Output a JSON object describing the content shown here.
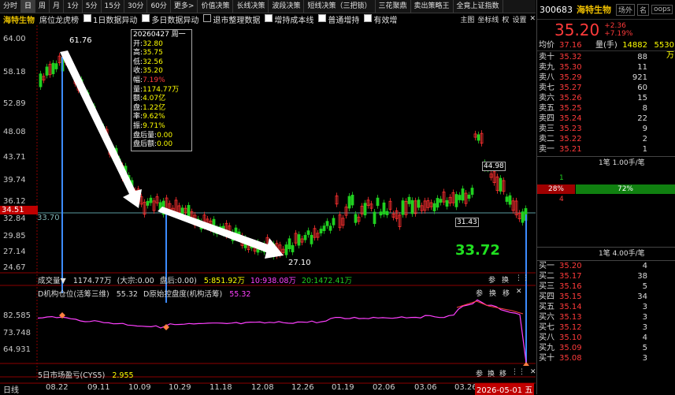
{
  "toolbar": {
    "items": [
      "分时",
      "日",
      "周",
      "月",
      "1分",
      "5分",
      "15分",
      "30分",
      "60分",
      "更多>",
      "价值决策",
      "长线决策",
      "波段决策",
      "短线决策（三把锁）",
      "三花聚鼎",
      "卖出策略王",
      "全竟上证指数"
    ],
    "active_index": 1
  },
  "info_bar": {
    "stock_name": "海特生物",
    "tag1": "席位龙虎榜",
    "checks": [
      {
        "label": "1日数据异动",
        "on": true
      },
      {
        "label": "多日数据异动",
        "on": true
      },
      {
        "label": "退市整理数据",
        "on": false
      },
      {
        "label": "增持成本线",
        "on": true
      },
      {
        "label": "普通增持",
        "on": true
      },
      {
        "label": "有效增",
        "on": true
      }
    ],
    "right_icons": [
      "主图",
      "坐标线",
      "权",
      "设置"
    ]
  },
  "main_chart": {
    "y_ticks": [
      "64.00",
      "58.18",
      "52.89",
      "48.08",
      "43.71",
      "39.74",
      "36.12",
      "32.84",
      "29.85",
      "27.14",
      "24.67"
    ],
    "current_price_tag": "34.51",
    "ref_line_label": "33.70",
    "high_mark": "61.76",
    "low_mark": "27.10",
    "mark_right1": "44.98",
    "mark_right2": "31.43",
    "big_price": "33.72",
    "tooltip": {
      "header": "20260427 周一",
      "rows": [
        {
          "k": "开",
          "v": "32.80",
          "c": "#ffff00"
        },
        {
          "k": "高",
          "v": "35.75",
          "c": "#ffff00"
        },
        {
          "k": "低",
          "v": "32.56",
          "c": "#ffff00"
        },
        {
          "k": "收",
          "v": "35.20",
          "c": "#ffff00"
        },
        {
          "k": "幅",
          "v": "7.19%",
          "c": "#ff3a3a"
        },
        {
          "k": "量",
          "v": "1174.77万",
          "c": "#ffff00"
        },
        {
          "k": "额",
          "v": "4.07亿",
          "c": "#ffff00"
        },
        {
          "k": "盘",
          "v": "1.22亿",
          "c": "#ffff00"
        },
        {
          "k": "率",
          "v": "9.62%",
          "c": "#ffff00"
        },
        {
          "k": "振",
          "v": "9.71%",
          "c": "#ffff00"
        },
        {
          "k": "盘后量",
          "v": "0.00",
          "c": "#ffff00"
        },
        {
          "k": "盘后额",
          "v": "0.00",
          "c": "#ffff00"
        }
      ]
    }
  },
  "volume_bar": {
    "label": "成交量▼",
    "value": "1174.77万",
    "paren": "(大宗:0.00",
    "after": "盘后:0.00)",
    "ma5": "5:851.92万",
    "ma10": "10:938.08万",
    "ma20": "20:1472.41万",
    "btns": [
      "参",
      "换",
      "⋮⋮",
      "✕"
    ]
  },
  "indicator1": {
    "title": "D机构仓位(活筹三维)",
    "value": "55.32",
    "title2": "D原始控盘度(机构活筹)",
    "value2": "55.32",
    "y_ticks": [
      "82.585",
      "73.748",
      "64.931"
    ],
    "btns": [
      "参",
      "换",
      "移",
      "✕"
    ]
  },
  "indicator2": {
    "title": "5日市场盈亏(CYS5)",
    "value": "2.955",
    "btns": [
      "参",
      "换",
      "移",
      "⋮⋮",
      "✕"
    ]
  },
  "x_axis": {
    "label": "日线",
    "ticks": [
      "08.22",
      "09.11",
      "10.09",
      "10.29",
      "11.18",
      "12.08",
      "12.26",
      "01.19",
      "02.06",
      "03.06",
      "03.26"
    ],
    "current": "2026-05-01 五"
  },
  "right_panel": {
    "code": "300683",
    "name": "海特生物",
    "btns": [
      "场外",
      "名",
      "oops"
    ],
    "price": "35.20",
    "change": "+2.36",
    "change_pct": "+7.19%",
    "avg_label": "均价",
    "avg": "37.16",
    "vol_label": "量(手)",
    "vol": "14882",
    "vol2": "5530万",
    "asks": [
      {
        "l": "卖十",
        "p": "35.32",
        "v": "88"
      },
      {
        "l": "卖九",
        "p": "35.30",
        "v": "11"
      },
      {
        "l": "卖八",
        "p": "35.29",
        "v": "921"
      },
      {
        "l": "卖七",
        "p": "35.27",
        "v": "60"
      },
      {
        "l": "卖六",
        "p": "35.26",
        "v": "15"
      },
      {
        "l": "卖五",
        "p": "35.25",
        "v": "8"
      },
      {
        "l": "卖四",
        "p": "35.24",
        "v": "22"
      },
      {
        "l": "卖三",
        "p": "35.23",
        "v": "9"
      },
      {
        "l": "卖二",
        "p": "35.22",
        "v": "2"
      },
      {
        "l": "卖一",
        "p": "35.21",
        "v": "1"
      }
    ],
    "ask_note": "1笔 1.00手/笔",
    "ratio_buy": "28%",
    "ratio_sell": "72%",
    "ratio_buy_num": "4",
    "ratio_sell_num": "1",
    "bid_note": "1笔 4.00手/笔",
    "bids": [
      {
        "l": "买一",
        "p": "35.20",
        "v": "4"
      },
      {
        "l": "买二",
        "p": "35.17",
        "v": "38"
      },
      {
        "l": "买三",
        "p": "35.16",
        "v": "5"
      },
      {
        "l": "买四",
        "p": "35.15",
        "v": "34"
      },
      {
        "l": "买五",
        "p": "35.14",
        "v": "3"
      },
      {
        "l": "买六",
        "p": "35.13",
        "v": "3"
      },
      {
        "l": "买七",
        "p": "35.12",
        "v": "3"
      },
      {
        "l": "买八",
        "p": "35.10",
        "v": "4"
      },
      {
        "l": "买九",
        "p": "35.09",
        "v": "5"
      },
      {
        "l": "买十",
        "p": "35.08",
        "v": "3"
      }
    ]
  }
}
